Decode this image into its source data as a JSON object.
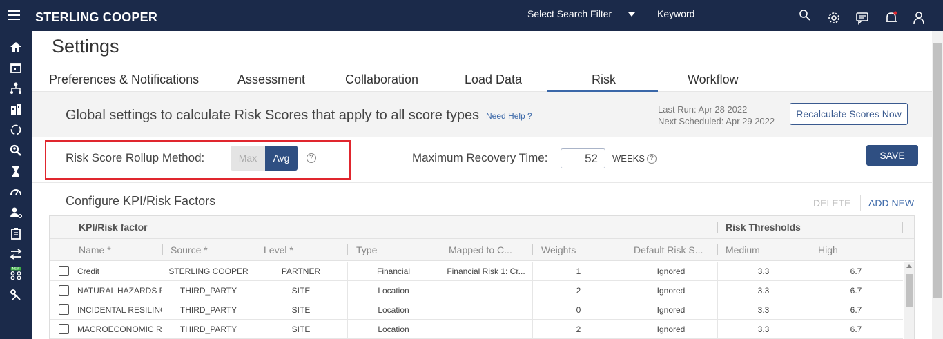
{
  "app": {
    "brand": "STERLING COOPER"
  },
  "topbar": {
    "search_filter": "Select Search Filter",
    "keyword_placeholder": "Keyword",
    "icons": [
      "menu-icon",
      "search-icon",
      "gear-icon",
      "chat-icon",
      "bell-icon",
      "user-icon"
    ]
  },
  "leftnav": {
    "icons": [
      "home-icon",
      "calendar-icon",
      "org-chart-icon",
      "buildings-icon",
      "refresh-icon",
      "search-person-icon",
      "hourglass-icon",
      "gauge-icon",
      "user-gear-icon",
      "clipboard-icon",
      "transfer-icon",
      "new-network-icon",
      "tools-icon"
    ]
  },
  "page": {
    "title": "Settings"
  },
  "tabs": [
    {
      "label": "Preferences & Notifications"
    },
    {
      "label": "Assessment"
    },
    {
      "label": "Collaboration"
    },
    {
      "label": "Load Data"
    },
    {
      "label": "Risk",
      "active": true
    },
    {
      "label": "Workflow"
    }
  ],
  "global": {
    "text": "Global settings to calculate Risk Scores that apply to all score types",
    "help": "Need Help ?",
    "last_run": "Last Run: Apr 28 2022",
    "next_scheduled": "Next Scheduled: Apr 29 2022",
    "recalc_button": "Recalculate Scores Now"
  },
  "rollup": {
    "label": "Risk Score Rollup Method:",
    "options": [
      "Max",
      "Avg"
    ],
    "selected": "Avg"
  },
  "recovery": {
    "label": "Maximum Recovery Time:",
    "value": "52",
    "unit": "WEEKS"
  },
  "save_button": "SAVE",
  "kpi": {
    "heading": "Configure KPI/Risk Factors",
    "delete": "DELETE",
    "add_new": "ADD NEW",
    "group_headers": {
      "factor": "KPI/Risk factor",
      "thresholds": "Risk Thresholds"
    },
    "columns": [
      "Name *",
      "Source *",
      "Level *",
      "Type",
      "Mapped to C...",
      "Weights",
      "Default Risk S...",
      "Medium",
      "High"
    ],
    "rows": [
      {
        "name": "Credit",
        "source": "STERLING COOPER",
        "level": "PARTNER",
        "type": "Financial",
        "mapped": "Financial Risk 1: Cr...",
        "weight": "1",
        "default": "Ignored",
        "medium": "3.3",
        "high": "6.7"
      },
      {
        "name": "NATURAL HAZARDS RE",
        "source": "THIRD_PARTY",
        "level": "SITE",
        "type": "Location",
        "mapped": "",
        "weight": "2",
        "default": "Ignored",
        "medium": "3.3",
        "high": "6.7"
      },
      {
        "name": "INCIDENTAL RESILINC",
        "source": "THIRD_PARTY",
        "level": "SITE",
        "type": "Location",
        "mapped": "",
        "weight": "0",
        "default": "Ignored",
        "medium": "3.3",
        "high": "6.7"
      },
      {
        "name": "MACROECONOMIC RES",
        "source": "THIRD_PARTY",
        "level": "SITE",
        "type": "Location",
        "mapped": "",
        "weight": "2",
        "default": "Ignored",
        "medium": "3.3",
        "high": "6.7"
      }
    ]
  }
}
